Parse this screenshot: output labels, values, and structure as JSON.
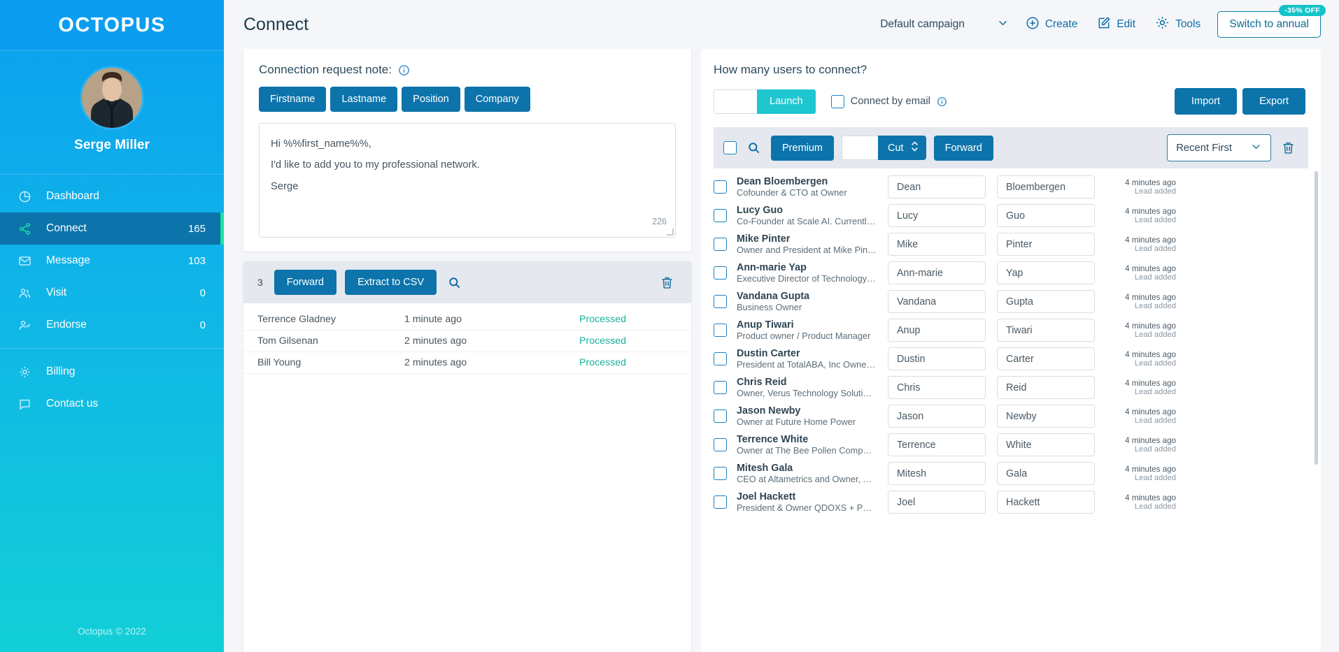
{
  "sidebar": {
    "logo": "OCTOPUS",
    "profile_name": "Serge Miller",
    "items": [
      {
        "label": "Dashboard",
        "count": "",
        "icon": "dashboard-icon"
      },
      {
        "label": "Connect",
        "count": "165",
        "icon": "share-icon"
      },
      {
        "label": "Message",
        "count": "103",
        "icon": "envelope-icon"
      },
      {
        "label": "Visit",
        "count": "0",
        "icon": "users-icon"
      },
      {
        "label": "Endorse",
        "count": "0",
        "icon": "user-check-icon"
      }
    ],
    "secondary_items": [
      {
        "label": "Billing",
        "icon": "gear-icon"
      },
      {
        "label": "Contact us",
        "icon": "chat-icon"
      }
    ],
    "footer": "Octopus © 2022"
  },
  "topbar": {
    "page_title": "Connect",
    "campaign_value": "Default campaign",
    "create_label": "Create",
    "edit_label": "Edit",
    "tools_label": "Tools",
    "switch_label": "Switch to annual",
    "discount_badge": "-35% OFF"
  },
  "note": {
    "heading": "Connection request note:",
    "tags": [
      "Firstname",
      "Lastname",
      "Position",
      "Company"
    ],
    "body_lines": [
      "Hi %%first_name%%,",
      "",
      "I'd like to add you to my professional network.",
      "",
      "Serge"
    ],
    "char_counter": "226"
  },
  "processed": {
    "count": "3",
    "forward_label": "Forward",
    "extract_label": "Extract to CSV",
    "rows": [
      {
        "name": "Terrence Gladney",
        "time": "1 minute ago",
        "status": "Processed"
      },
      {
        "name": "Tom Gilsenan",
        "time": "2 minutes ago",
        "status": "Processed"
      },
      {
        "name": "Bill Young",
        "time": "2 minutes ago",
        "status": "Processed"
      }
    ]
  },
  "right_panel": {
    "title": "How many users to connect?",
    "amount_value": "",
    "launch_label": "Launch",
    "connect_by_email_label": "Connect by email",
    "import_label": "Import",
    "export_label": "Export",
    "premium_label": "Premium",
    "cut_value": "",
    "cut_label": "Cut",
    "forward_label": "Forward",
    "sort_value": "Recent First",
    "users": [
      {
        "name": "Dean Bloembergen",
        "title": "Cofounder & CTO at Owner",
        "first": "Dean",
        "last": "Bloembergen",
        "ago": "4 minutes ago",
        "lead": "Lead added"
      },
      {
        "name": "Lucy Guo",
        "title": "Co-Founder at Scale AI. Currently ...",
        "first": "Lucy",
        "last": "Guo",
        "ago": "4 minutes ago",
        "lead": "Lead added"
      },
      {
        "name": "Mike Pinter",
        "title": "Owner and President at Mike Pint...",
        "first": "Mike",
        "last": "Pinter",
        "ago": "4 minutes ago",
        "lead": "Lead added"
      },
      {
        "name": "Ann-marie Yap",
        "title": "Executive Director of Technology ...",
        "first": "Ann-marie",
        "last": "Yap",
        "ago": "4 minutes ago",
        "lead": "Lead added"
      },
      {
        "name": "Vandana Gupta",
        "title": "Business Owner",
        "first": "Vandana",
        "last": "Gupta",
        "ago": "4 minutes ago",
        "lead": "Lead added"
      },
      {
        "name": "Anup Tiwari",
        "title": "Product owner / Product Manager",
        "first": "Anup",
        "last": "Tiwari",
        "ago": "4 minutes ago",
        "lead": "Lead added"
      },
      {
        "name": "Dustin Carter",
        "title": "President at TotalABA, Inc Owner ...",
        "first": "Dustin",
        "last": "Carter",
        "ago": "4 minutes ago",
        "lead": "Lead added"
      },
      {
        "name": "Chris Reid",
        "title": "Owner, Verus Technology Solutions",
        "first": "Chris",
        "last": "Reid",
        "ago": "4 minutes ago",
        "lead": "Lead added"
      },
      {
        "name": "Jason Newby",
        "title": "Owner at Future Home Power",
        "first": "Jason",
        "last": "Newby",
        "ago": "4 minutes ago",
        "lead": "Lead added"
      },
      {
        "name": "Terrence White",
        "title": "Owner at The Bee Pollen Company",
        "first": "Terrence",
        "last": "White",
        "ago": "4 minutes ago",
        "lead": "Lead added"
      },
      {
        "name": "Mitesh Gala",
        "title": "CEO at Altametrics and Owner, Alt...",
        "first": "Mitesh",
        "last": "Gala",
        "ago": "4 minutes ago",
        "lead": "Lead added"
      },
      {
        "name": "Joel Hackett",
        "title": "President & Owner QDOXS + Part...",
        "first": "Joel",
        "last": "Hackett",
        "ago": "4 minutes ago",
        "lead": "Lead added"
      }
    ]
  },
  "colors": {
    "brand_blue": "#0c74ab",
    "sidebar_top": "#0aa0ef",
    "sidebar_bottom": "#12cfd6",
    "accent_teal": "#1ec7cf",
    "active_green": "#19e3a0",
    "status_green": "#17b39b"
  }
}
